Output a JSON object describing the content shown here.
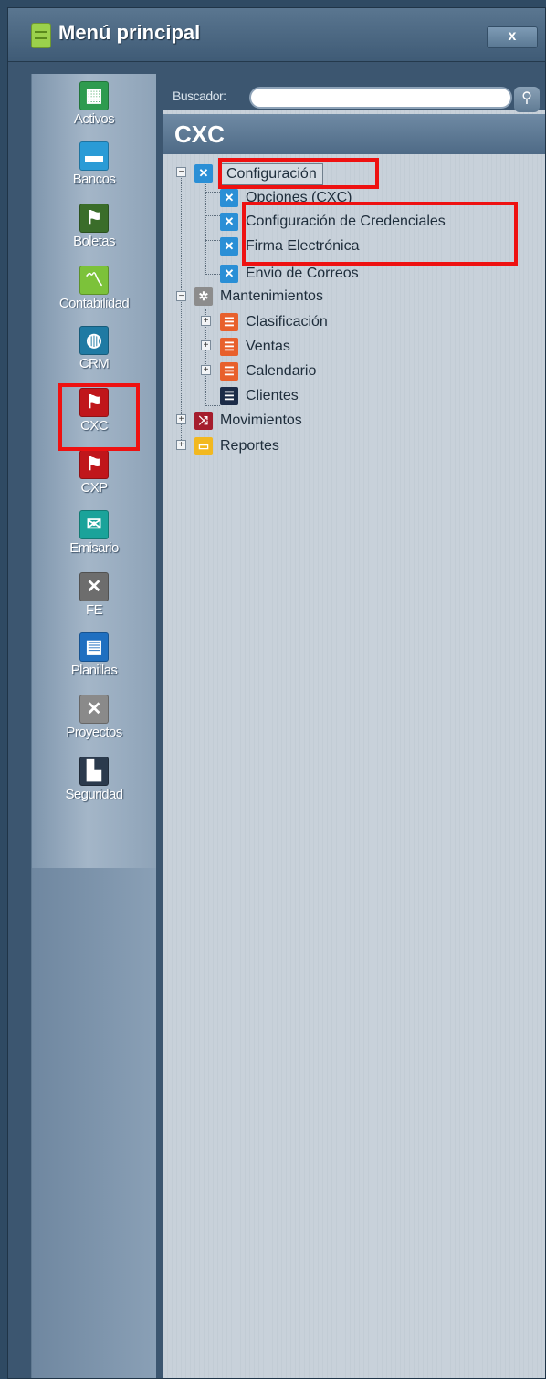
{
  "window": {
    "title": "Menú principal",
    "close_label": "x"
  },
  "rail": {
    "items": [
      {
        "label": "Activos",
        "icon": "cash-register-icon",
        "color": "#2e9b4f",
        "glyph": "▦"
      },
      {
        "label": "Bancos",
        "icon": "briefcase-icon",
        "color": "#2a9bd6",
        "glyph": "▬"
      },
      {
        "label": "Boletas",
        "icon": "trash-person-icon",
        "color": "#3a6d2a",
        "glyph": "⚑"
      },
      {
        "label": "Contabilidad",
        "icon": "chart-icon",
        "color": "#7cc23a",
        "glyph": "〽"
      },
      {
        "label": "CRM",
        "icon": "globe-icon",
        "color": "#1f7aa3",
        "glyph": "◍"
      },
      {
        "label": "CXC",
        "icon": "person-receivable-icon",
        "color": "#c0161b",
        "glyph": "⚑"
      },
      {
        "label": "CXP",
        "icon": "person-payable-icon",
        "color": "#c0161b",
        "glyph": "⚑"
      },
      {
        "label": "Emisario",
        "icon": "envelope-icon",
        "color": "#1aa39a",
        "glyph": "✉"
      },
      {
        "label": "FE",
        "icon": "tools-icon",
        "color": "#6d6d6d",
        "glyph": "✕"
      },
      {
        "label": "Planillas",
        "icon": "document-icon",
        "color": "#1f6fc0",
        "glyph": "▤"
      },
      {
        "label": "Proyectos",
        "icon": "wrench-icon",
        "color": "#8a8a8a",
        "glyph": "✕"
      },
      {
        "label": "Seguridad",
        "icon": "factory-icon",
        "color": "#2b3a4d",
        "glyph": "▙"
      }
    ]
  },
  "search": {
    "label": "Buscador:",
    "value": "",
    "button_icon": "magnifier-icon",
    "button_glyph": "⚲"
  },
  "panel": {
    "title": "CXC"
  },
  "tree": {
    "configuracion": {
      "label": "Configuración",
      "icon": "tools-icon",
      "color": "#2a8fd6",
      "glyph": "✕"
    },
    "opciones": {
      "label": "Opciones (CXC)",
      "icon": "tools-icon",
      "color": "#2a8fd6",
      "glyph": "✕"
    },
    "credenciales": {
      "label": "Configuración de Credenciales",
      "icon": "tools-icon",
      "color": "#2a8fd6",
      "glyph": "✕"
    },
    "firma": {
      "label": "Firma Electrónica",
      "icon": "tools-icon",
      "color": "#2a8fd6",
      "glyph": "✕"
    },
    "correos": {
      "label": "Envio de Correos",
      "icon": "tools-icon",
      "color": "#2a8fd6",
      "glyph": "✕"
    },
    "mantenimientos": {
      "label": "Mantenimientos",
      "icon": "gear-icon",
      "color": "#8c8c8c",
      "glyph": "✲"
    },
    "clasificacion": {
      "label": "Clasificación",
      "icon": "list-icon",
      "color": "#e8602c",
      "glyph": "☰"
    },
    "ventas": {
      "label": "Ventas",
      "icon": "list-icon",
      "color": "#e8602c",
      "glyph": "☰"
    },
    "calendario": {
      "label": "Calendario",
      "icon": "list-icon",
      "color": "#e8602c",
      "glyph": "☰"
    },
    "clientes": {
      "label": "Clientes",
      "icon": "list-icon",
      "color": "#1c2c48",
      "glyph": "☰"
    },
    "movimientos": {
      "label": "Movimientos",
      "icon": "shuffle-icon",
      "color": "#a51d2d",
      "glyph": "⤨"
    },
    "reportes": {
      "label": "Reportes",
      "icon": "report-icon",
      "color": "#f2b81f",
      "glyph": "▭"
    }
  },
  "highlight_color": "#ee1111"
}
